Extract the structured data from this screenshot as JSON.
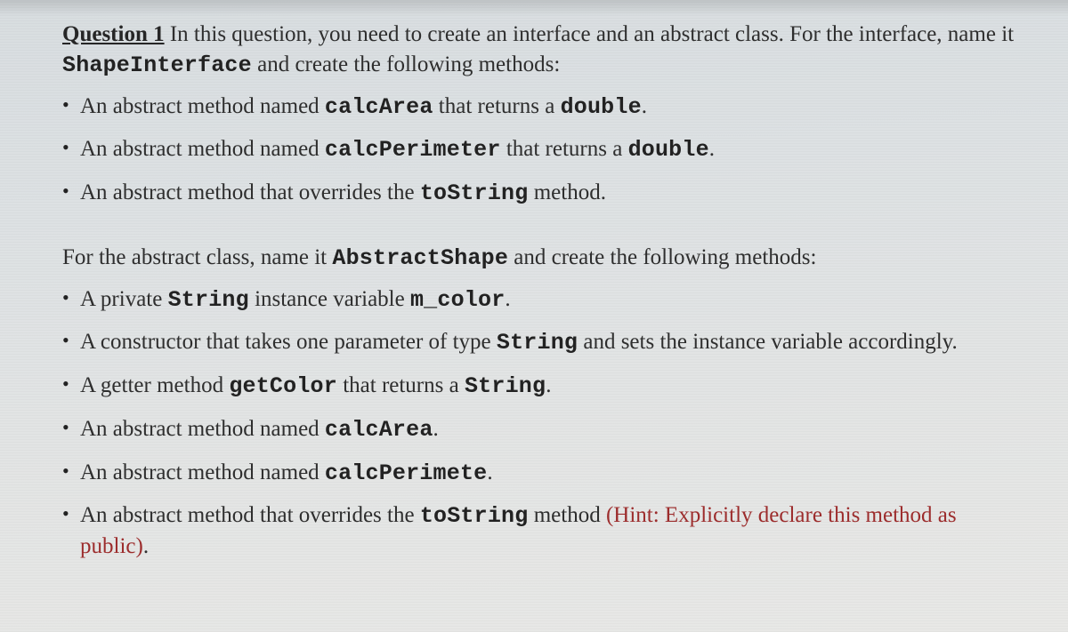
{
  "question": {
    "label": "Question 1",
    "intro_before_code": " In this question, you need to create an interface and an abstract class. For the interface, name it ",
    "intro_code": "ShapeInterface",
    "intro_after_code": " and create the following methods:"
  },
  "interface_items": [
    {
      "t1": "An abstract method named ",
      "c1": "calcArea",
      "t2": " that returns a ",
      "c2": "double",
      "t3": "."
    },
    {
      "t1": "An abstract method named ",
      "c1": "calcPerimeter",
      "t2": " that returns a ",
      "c2": "double",
      "t3": "."
    },
    {
      "t1": "An abstract method that overrides the ",
      "c1": "toString",
      "t2": " method.",
      "c2": "",
      "t3": ""
    }
  ],
  "abstract_intro": {
    "t1": "For the abstract class, name it ",
    "c1": "AbstractShape",
    "t2": " and create the following methods:"
  },
  "abstract_items": {
    "i1": {
      "a": "A private ",
      "b": "String",
      "c": " instance variable ",
      "d": "m_color",
      "e": "."
    },
    "i2": {
      "a": "A constructor that takes one parameter of type ",
      "b": "String",
      "c": " and sets the instance variable accordingly."
    },
    "i3": {
      "a": "A getter method ",
      "b": "getColor",
      "c": " that returns a ",
      "d": "String",
      "e": "."
    },
    "i4": {
      "a": "An abstract method named ",
      "b": "calcArea",
      "c": "."
    },
    "i5": {
      "a": "An abstract method named ",
      "b": "calcPerimete",
      "c": "."
    },
    "i6": {
      "a": "An abstract method that overrides the ",
      "b": "toString",
      "c": "  method  ",
      "hint": "(Hint: Explicitly declare this method as public)",
      "e": "."
    }
  }
}
